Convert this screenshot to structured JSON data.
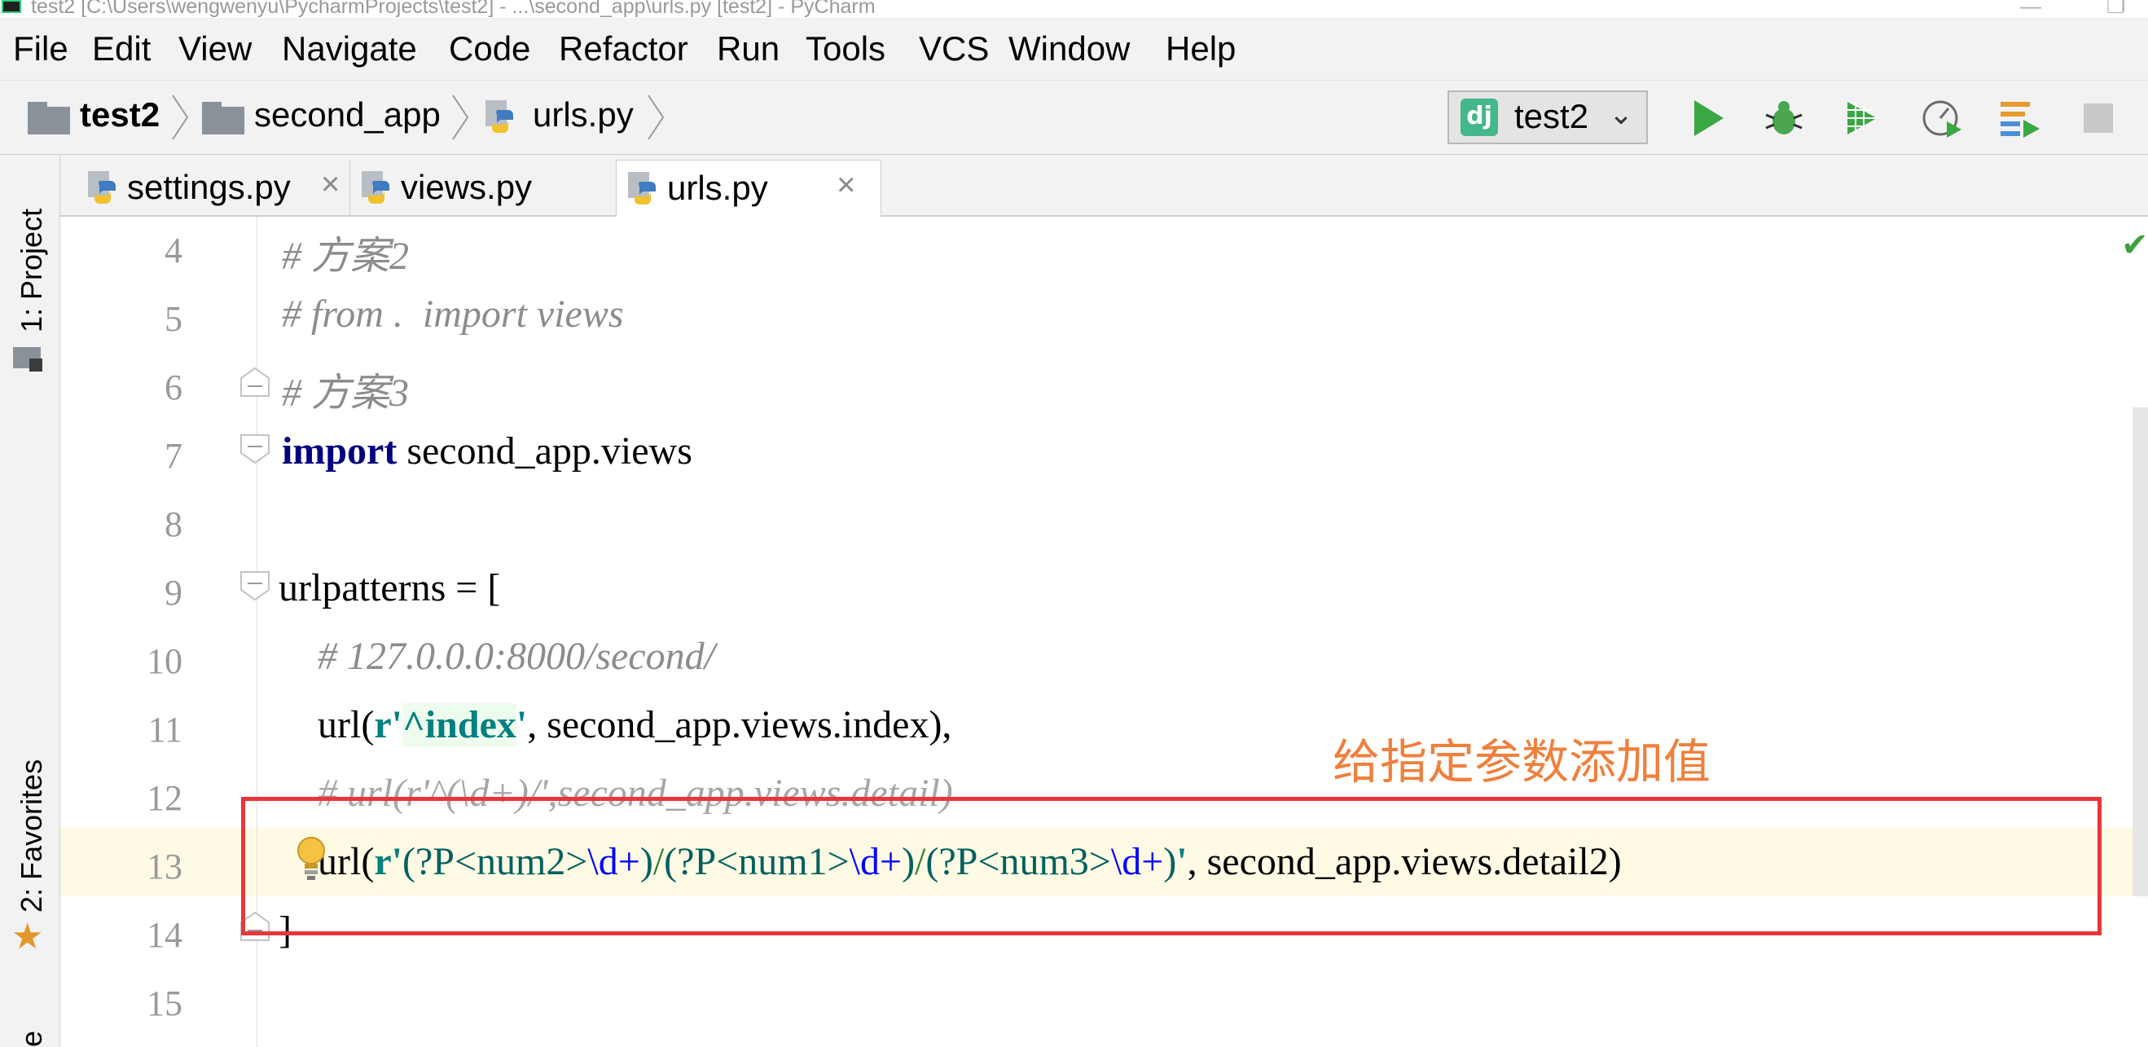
{
  "window": {
    "title": "test2 [C:\\Users\\wengwenyu\\PycharmProjects\\test2] - ...\\second_app\\urls.py [test2] - PyCharm"
  },
  "menu": [
    "File",
    "Edit",
    "View",
    "Navigate",
    "Code",
    "Refactor",
    "Run",
    "Tools",
    "VCS",
    "Window",
    "Help"
  ],
  "breadcrumb": {
    "project": "test2",
    "folder": "second_app",
    "file": "urls.py"
  },
  "run_config": {
    "name": "test2",
    "icon": "django-icon"
  },
  "toolbar_icons": [
    "run-icon",
    "debug-icon",
    "coverage-icon",
    "profile-icon",
    "concurrency-icon",
    "stop-icon"
  ],
  "left_strip": {
    "project_label": "1: Project",
    "favorites_label": "2: Favorites",
    "bottom_label": "e"
  },
  "tabs": [
    {
      "label": "settings.py",
      "active": false
    },
    {
      "label": "views.py",
      "active": false
    },
    {
      "label": "urls.py",
      "active": true
    }
  ],
  "code_lines": [
    {
      "num": "4",
      "text": "# 方案2"
    },
    {
      "num": "5",
      "text": "# from .  import views"
    },
    {
      "num": "6",
      "text": "# 方案3"
    },
    {
      "num": "7",
      "text": "import second_app.views"
    },
    {
      "num": "8",
      "text": ""
    },
    {
      "num": "9",
      "text": "urlpatterns = ["
    },
    {
      "num": "10",
      "text": "    # 127.0.0.0:8000/second/"
    },
    {
      "num": "11",
      "text": "    url(r'^index', second_app.views.index),"
    },
    {
      "num": "12",
      "text": "    # url(r'^(\\d+)/',second_app.views.detail)"
    },
    {
      "num": "13",
      "text": "    url(r'(?P<num2>\\d+)/(?P<num1>\\d+)/(?P<num3>\\d+)', second_app.views.detail2)"
    },
    {
      "num": "14",
      "text": "]"
    },
    {
      "num": "15",
      "text": ""
    }
  ],
  "annotation": {
    "note": "给指定参数添加值",
    "note_color": "#f07f3c",
    "box_color": "#e8363b"
  },
  "colors": {
    "keyword": "#000080",
    "string": "#008080",
    "comment": "#8c8c8c",
    "current_line": "#fffae3"
  }
}
